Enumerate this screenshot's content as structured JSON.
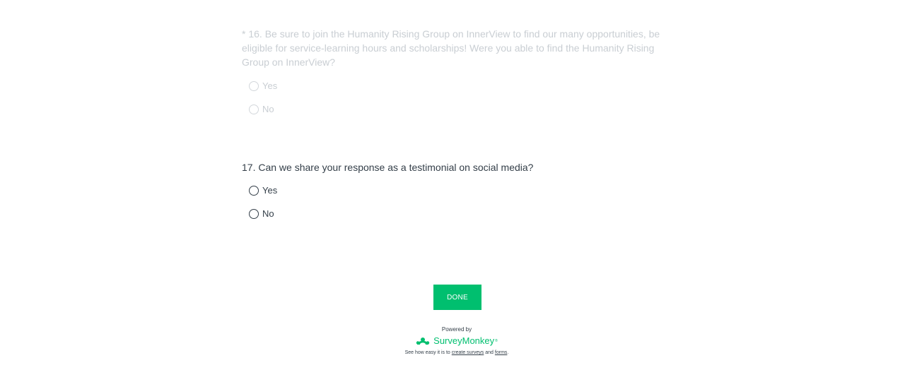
{
  "questions": [
    {
      "title": "* 16. Be sure to join the Humanity Rising Group on InnerView to find our many opportunities, be eligible for service-learning hours and scholarships! Were you able to find the Humanity Rising Group on InnerView?",
      "options": [
        "Yes",
        "No"
      ],
      "state": "disabled"
    },
    {
      "title": "17. Can we share your response as a testimonial on social media?",
      "options": [
        "Yes",
        "No"
      ],
      "state": "active"
    }
  ],
  "done_label": "DONE",
  "footer": {
    "powered_by": "Powered by",
    "brand_name": "SurveyMonkey",
    "brand_tm": "®",
    "tagline_prefix": "See how easy it is to",
    "link_surveys": "create surveys",
    "tagline_and": "and",
    "link_forms": "forms",
    "tagline_suffix": "."
  },
  "colors": {
    "accent": "#00bf6f",
    "text": "#333e48",
    "disabled_text": "#c9ced3"
  },
  "icons": {
    "brand_logo": "surveymonkey-logo-icon",
    "radio": "radio-circle-icon"
  }
}
